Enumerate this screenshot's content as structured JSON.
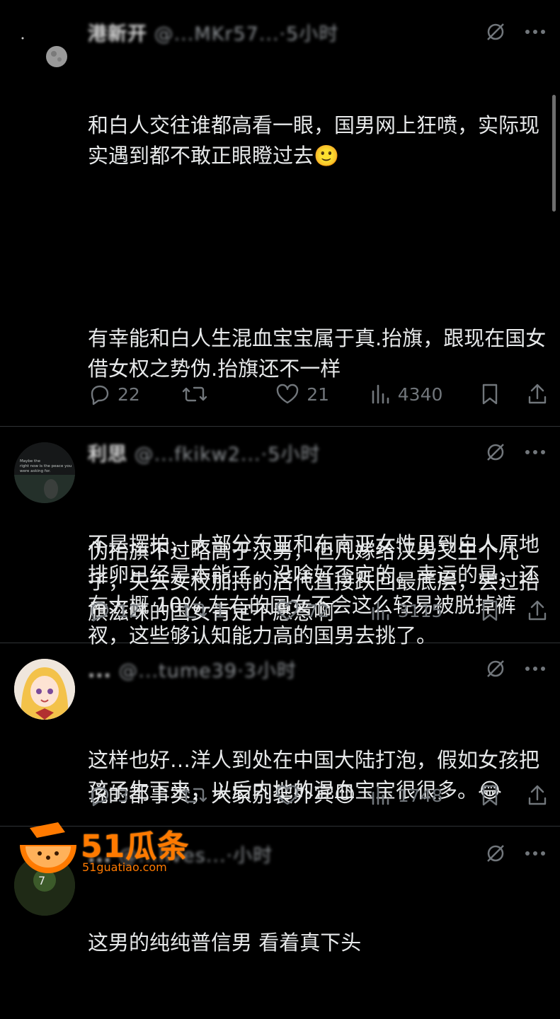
{
  "posts": [
    {
      "header": {
        "name": "港新开",
        "handle": "@...MKr57...·5小时",
        "time": "5小时"
      },
      "paragraphs": [
        "和白人交往谁都高看一眼，国男网上狂喷，实际现实遇到都不敢正眼瞪过去🙂",
        "有幸能和白人生混血宝宝属于真.抬旗，跟现在国女借女权之势伪.抬旗还不一样",
        "伪抬旗不过略高于汉男，但凡嫁给汉男又生个儿子，失去女权加持的后代直接跌回最底层，尝过抬旗滋味的国女肯定不愿意啊",
        "说的都事实，大家别装外宾😊"
      ],
      "stats": {
        "replies": "22",
        "reposts": "",
        "likes": "21",
        "views": "4340"
      },
      "avatar_text": ""
    },
    {
      "header": {
        "name": "利思",
        "handle": "@...fkikw2...·5小时",
        "time": "5小时"
      },
      "paragraphs": [
        "不是摆拍，大部分东亚和东南亚女性见到白人原地排卵已经是本能了，没啥好否定的。幸运的是，还有大概 10% 左右的国女不会这么轻易被脱掉裤衩，这些够认知能力高的国男去挑了。"
      ],
      "stats": {
        "replies": "12",
        "reposts": "1",
        "likes": "72",
        "views": "3115"
      },
      "avatar_text": "Maybe the right now is the peace you were asking for."
    },
    {
      "header": {
        "name": "...",
        "handle": "@...tume39·3小时",
        "time": "3小时"
      },
      "paragraphs": [
        "这样也好…洋人到处在中国大陆打泡，假如女孩把孩子生下来，以后内地的混血宝宝很很多。😂"
      ],
      "stats": {
        "replies": "3",
        "reposts": "",
        "likes": "",
        "views": "1748"
      },
      "avatar_text": ""
    },
    {
      "header": {
        "name": "...",
        "handle": "@...lives...·小时",
        "time": "小时"
      },
      "paragraphs": [
        "这男的纯纯普信男 看着真下头"
      ],
      "stats": {
        "replies": "",
        "reposts": "",
        "likes": "",
        "views": ""
      },
      "avatar_text": ""
    }
  ],
  "watermark": {
    "brand": "51瓜条",
    "url": "51guatiao.com"
  },
  "icons": {
    "reply": "reply-icon",
    "repost": "repost-icon",
    "like": "like-icon",
    "views": "views-icon",
    "bookmark": "bookmark-icon",
    "share": "share-icon",
    "grok": "grok-icon",
    "more": "more-icon"
  },
  "colors": {
    "background": "#000000",
    "text": "#e7e9ea",
    "muted": "#71767b",
    "divider": "#2f3336",
    "watermark": "#ff7a00"
  }
}
